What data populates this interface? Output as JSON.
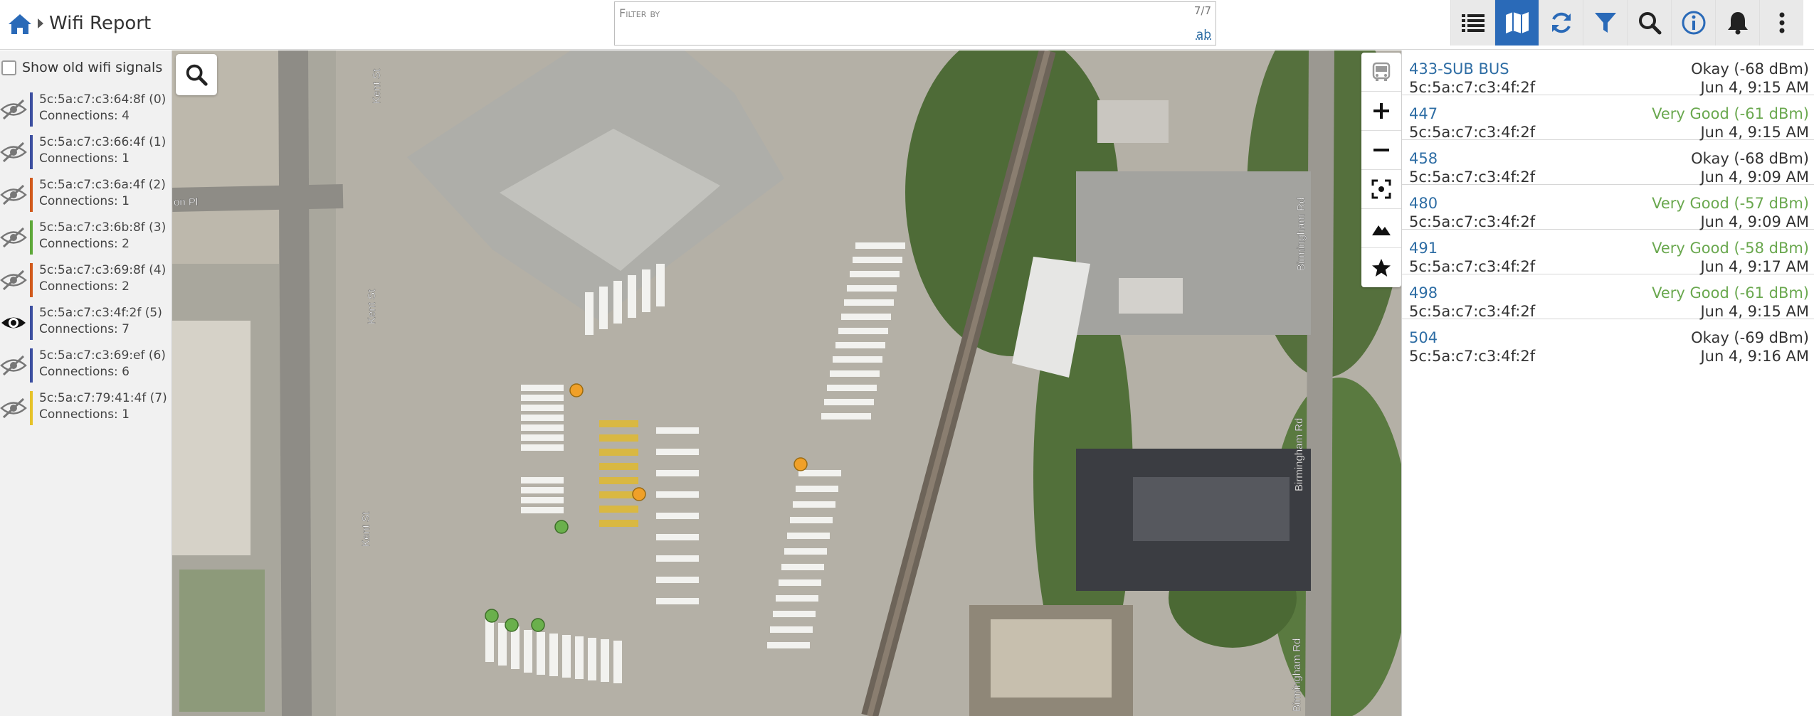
{
  "header": {
    "title": "Wifi Report",
    "home_icon": "home-icon"
  },
  "filter": {
    "placeholder": "Filter by",
    "value": "",
    "count": "7/7",
    "toggle_label": "ab"
  },
  "toolbar": {
    "buttons": [
      {
        "icon": "list-icon",
        "active": false
      },
      {
        "icon": "map-icon",
        "active": true
      },
      {
        "icon": "refresh-icon",
        "active": false
      },
      {
        "icon": "filter-icon",
        "active": false
      },
      {
        "icon": "search-icon",
        "active": false
      },
      {
        "icon": "info-icon",
        "active": false
      },
      {
        "icon": "bell-icon",
        "active": false
      },
      {
        "icon": "more-vertical-icon",
        "active": false
      }
    ]
  },
  "sidebar": {
    "show_old_label": "Show old wifi signals",
    "show_old_checked": false,
    "signals": [
      {
        "mac": "5c:5a:c7:c3:64:8f (0)",
        "connections": "Connections: 4",
        "color": "#3c4fa0",
        "visible": false
      },
      {
        "mac": "5c:5a:c7:c3:66:4f (1)",
        "connections": "Connections: 1",
        "color": "#3c4fa0",
        "visible": false
      },
      {
        "mac": "5c:5a:c7:c3:6a:4f (2)",
        "connections": "Connections: 1",
        "color": "#d15a1c",
        "visible": false
      },
      {
        "mac": "5c:5a:c7:c3:6b:8f (3)",
        "connections": "Connections: 2",
        "color": "#5ea83a",
        "visible": false
      },
      {
        "mac": "5c:5a:c7:c3:69:8f (4)",
        "connections": "Connections: 2",
        "color": "#d15a1c",
        "visible": false
      },
      {
        "mac": "5c:5a:c7:c3:4f:2f (5)",
        "connections": "Connections: 7",
        "color": "#3c4fa0",
        "visible": true
      },
      {
        "mac": "5c:5a:c7:c3:69:ef (6)",
        "connections": "Connections: 6",
        "color": "#3c4fa0",
        "visible": false
      },
      {
        "mac": "5c:5a:c7:79:41:4f (7)",
        "connections": "Connections: 1",
        "color": "#e6c229",
        "visible": false
      }
    ]
  },
  "map": {
    "street_labels": [
      "Kent St",
      "on Pl",
      "Kent St",
      "Kent St",
      "Birmingham Rd",
      "Birmingham Rd",
      "Birmingham Rd"
    ],
    "search_icon": "search-icon",
    "controls": [
      "bus-icon",
      "zoom-in-icon",
      "zoom-out-icon",
      "fit-bounds-icon",
      "terrain-icon",
      "star-icon"
    ],
    "marker_colors": {
      "okay": "#f0a028",
      "very_good": "#6ab04c"
    }
  },
  "devices": [
    {
      "name": "433-SUB BUS",
      "mac": "5c:5a:c7:c3:4f:2f",
      "quality": "Okay (-68 dBm)",
      "time": "Jun 4, 9:15 AM",
      "quality_color": "#333333"
    },
    {
      "name": "447",
      "mac": "5c:5a:c7:c3:4f:2f",
      "quality": "Very Good (-61 dBm)",
      "time": "Jun 4, 9:15 AM",
      "quality_color": "#6aa84f"
    },
    {
      "name": "458",
      "mac": "5c:5a:c7:c3:4f:2f",
      "quality": "Okay (-68 dBm)",
      "time": "Jun 4, 9:09 AM",
      "quality_color": "#333333"
    },
    {
      "name": "480",
      "mac": "5c:5a:c7:c3:4f:2f",
      "quality": "Very Good (-57 dBm)",
      "time": "Jun 4, 9:09 AM",
      "quality_color": "#6aa84f"
    },
    {
      "name": "491",
      "mac": "5c:5a:c7:c3:4f:2f",
      "quality": "Very Good (-58 dBm)",
      "time": "Jun 4, 9:17 AM",
      "quality_color": "#6aa84f"
    },
    {
      "name": "498",
      "mac": "5c:5a:c7:c3:4f:2f",
      "quality": "Very Good (-61 dBm)",
      "time": "Jun 4, 9:15 AM",
      "quality_color": "#6aa84f"
    },
    {
      "name": "504",
      "mac": "5c:5a:c7:c3:4f:2f",
      "quality": "Okay (-69 dBm)",
      "time": "Jun 4, 9:16 AM",
      "quality_color": "#333333"
    }
  ]
}
